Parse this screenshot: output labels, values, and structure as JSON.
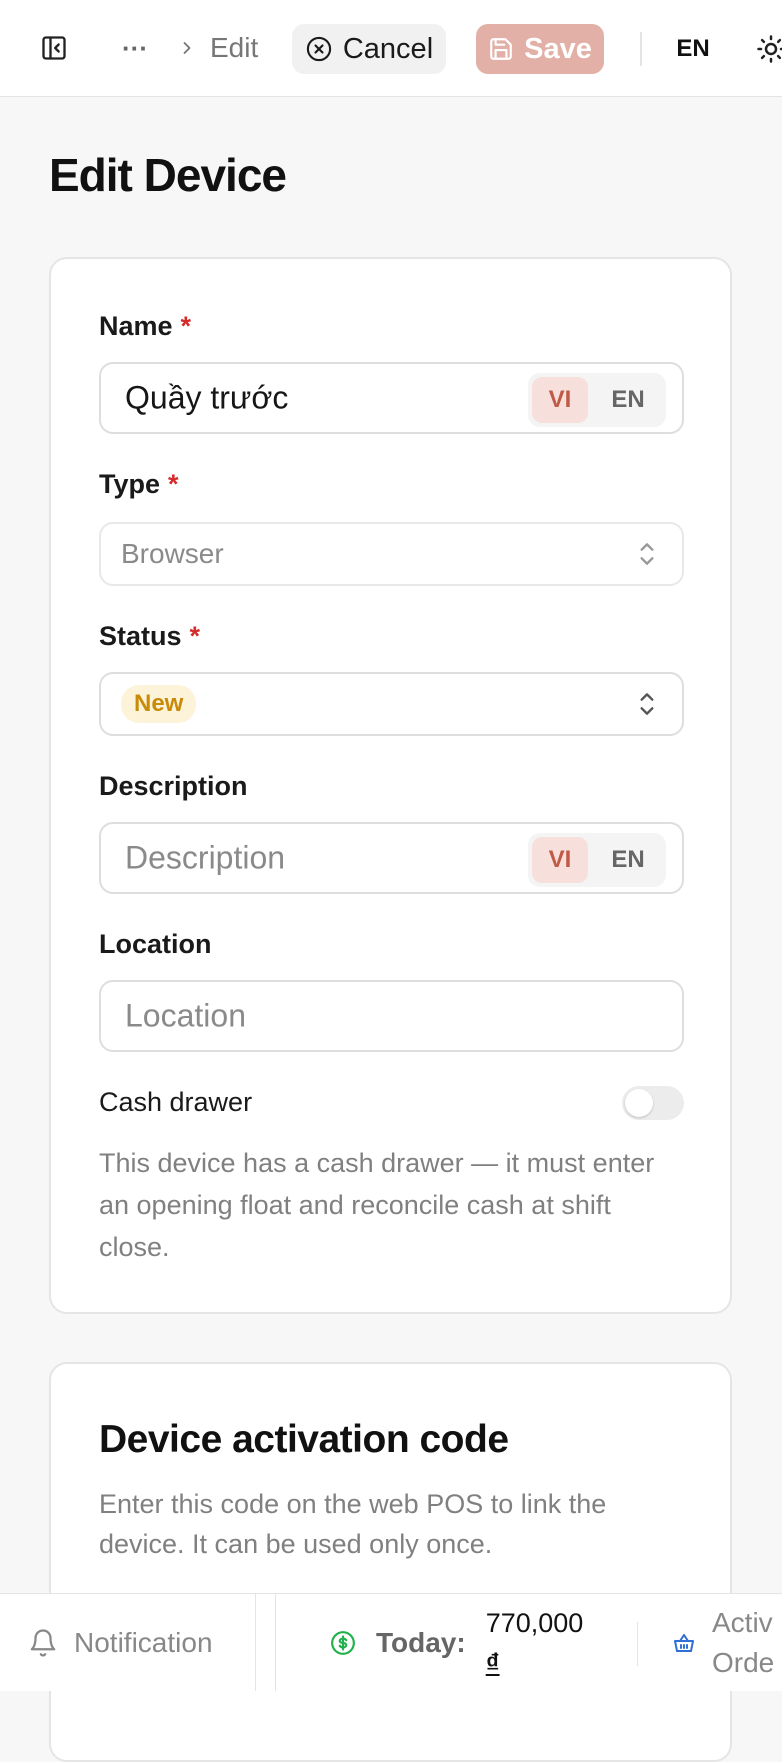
{
  "topbar": {
    "breadcrumb": {
      "ellipsis": "···",
      "current": "Edit"
    },
    "cancel_label": "Cancel",
    "save_label": "Save",
    "language": "EN"
  },
  "page": {
    "title": "Edit Device"
  },
  "form": {
    "name": {
      "label": "Name",
      "required_mark": "*",
      "value": "Quầy trước",
      "lang_active": "VI",
      "lang_other": "EN"
    },
    "type": {
      "label": "Type",
      "required_mark": "*",
      "value": "Browser"
    },
    "status": {
      "label": "Status",
      "required_mark": "*",
      "value": "New"
    },
    "description": {
      "label": "Description",
      "placeholder": "Description",
      "lang_active": "VI",
      "lang_other": "EN"
    },
    "location": {
      "label": "Location",
      "placeholder": "Location"
    },
    "cash_drawer": {
      "label": "Cash drawer",
      "enabled": false,
      "help": "This device has a cash drawer — it must enter an opening float and reconcile cash at shift close."
    }
  },
  "activation": {
    "title": "Device activation code",
    "description": "Enter this code on the web POS to link the device. It can be used only once."
  },
  "bottombar": {
    "notification_label": "Notification",
    "today_label": "Today:",
    "today_value": "770,000",
    "today_currency": "₫",
    "active_orders_line1": "Activ",
    "active_orders_line2": "Orde"
  },
  "colors": {
    "accent": "#c05a47",
    "save_disabled": "#e2b0a6",
    "required": "#d42b2b",
    "badge_new_bg": "#fdf3d8",
    "badge_new_text": "#c98a08",
    "money_icon": "#22b14c",
    "basket_icon": "#2f6fd6"
  },
  "icons": {
    "sidebar_toggle": "panel-left-icon",
    "breadcrumb_more": "ellipsis-icon",
    "breadcrumb_sep": "chevron-right-icon",
    "cancel": "x-circle-icon",
    "save": "save-icon",
    "theme": "sun-icon",
    "select": "chevrons-up-down-icon",
    "notification": "bell-icon",
    "today": "dollar-circle-icon",
    "orders": "basket-icon"
  }
}
